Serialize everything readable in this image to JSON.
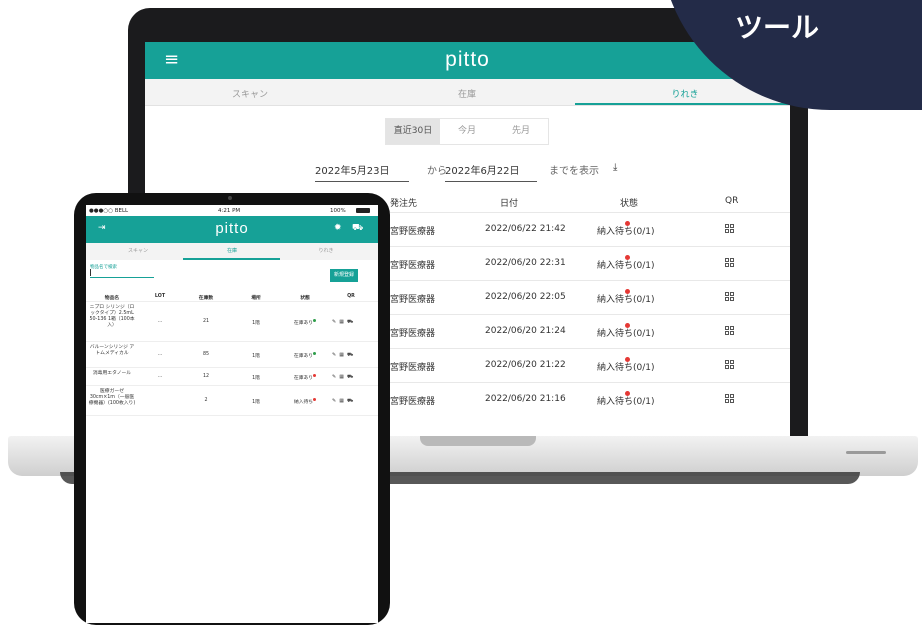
{
  "badge": {
    "text": "ツール",
    "color": "#232b48"
  },
  "colors": {
    "brand": "#16a197",
    "status_dot_red": "#e53935",
    "status_dot_green": "#2e9d4a"
  },
  "laptop": {
    "app": {
      "menu_icon": "hamburger-icon",
      "logo": "pitto",
      "tabs": [
        {
          "label": "スキャン"
        },
        {
          "label": "在庫"
        },
        {
          "label": "りれき",
          "active": true
        }
      ]
    },
    "range_buttons": [
      {
        "label": "直近30日",
        "active": true
      },
      {
        "label": "今月"
      },
      {
        "label": "先月"
      }
    ],
    "date_filter": {
      "from_date": "2022年5月23日",
      "from_label": "から",
      "to_date": "2022年6月22日",
      "to_label": "までを表示",
      "download_icon": "download-icon"
    },
    "history_table": {
      "columns": [
        "発注先",
        "日付",
        "状態",
        "QR"
      ],
      "rows": [
        {
          "supplier": "宮野医療器",
          "date": "2022/06/22 21:42",
          "status": "納入待ち(0/1)"
        },
        {
          "supplier": "宮野医療器",
          "date": "2022/06/20 22:31",
          "status": "納入待ち(0/1)"
        },
        {
          "supplier": "宮野医療器",
          "date": "2022/06/20 22:05",
          "status": "納入待ち(0/1)"
        },
        {
          "supplier": "宮野医療器",
          "date": "2022/06/20 21:24",
          "status": "納入待ち(0/1)"
        },
        {
          "supplier": "宮野医療器",
          "date": "2022/06/20 21:22",
          "status": "納入待ち(0/1)"
        },
        {
          "supplier": "宮野医療器",
          "date": "2022/06/20 21:16",
          "status": "納入待ち(0/1)"
        }
      ]
    }
  },
  "tablet": {
    "status_bar": {
      "carrier": "●●●○○ BELL",
      "time": "4:21 PM",
      "battery": "100%"
    },
    "app": {
      "logout_icon": "logout-icon",
      "logo": "pitto",
      "settings_icon": "gear-icon",
      "cart_icon": "cart-icon",
      "tabs": [
        {
          "label": "スキャン"
        },
        {
          "label": "在庫",
          "active": true
        },
        {
          "label": "りれき"
        }
      ]
    },
    "search": {
      "label": "物品名で検索",
      "value": ""
    },
    "new_button": "新規登録",
    "inventory_table": {
      "columns": [
        "物品名",
        "LOT",
        "在庫数",
        "場所",
        "状態",
        "QR"
      ],
      "rows": [
        {
          "name": "ニプロ シリンジ（ロックタイプ）2.5mL 50-136 1箱（100本入）",
          "lot": "...",
          "count": "21",
          "place": "1階",
          "status": "在庫あり",
          "dot": "green"
        },
        {
          "name": "バルーンシリンジ アトムメディカル",
          "lot": "...",
          "count": "85",
          "place": "1階",
          "status": "在庫あり",
          "dot": "green"
        },
        {
          "name": "消毒用エタノール",
          "lot": "...",
          "count": "12",
          "place": "1階",
          "status": "在庫あり",
          "dot": "red"
        },
        {
          "name": "医療ガーゼ 30cm×1m（一般医療機器）(100枚入り)",
          "lot": "",
          "count": "2",
          "place": "1階",
          "status": "納入待ち",
          "dot": "red"
        }
      ]
    }
  }
}
